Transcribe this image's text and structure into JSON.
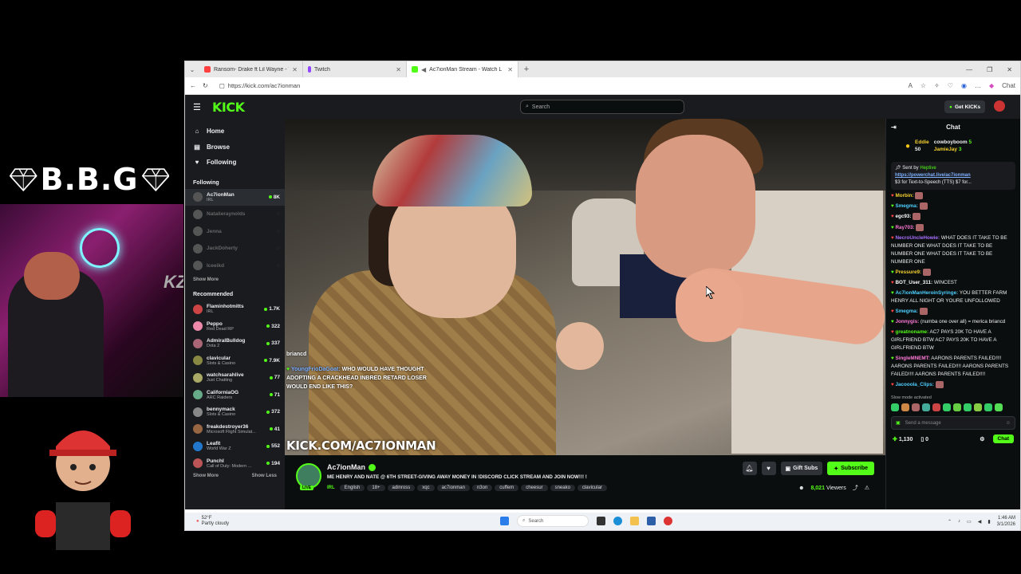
{
  "overlay": {
    "brand_text": "B.B.G",
    "cam_logo": "KZ"
  },
  "browser": {
    "tabs": [
      {
        "label": "Ransom- Drake ft Lil Wayne - You",
        "icon": "youtube-icon",
        "color": "#ff4040"
      },
      {
        "label": "Twitch",
        "icon": "twitch-icon",
        "color": "#9146ff"
      },
      {
        "label": "Ac7ionMan Stream - Watch L",
        "icon": "kick-icon",
        "color": "#53fc18"
      }
    ],
    "url": "https://kick.com/ac7ionman",
    "chat_label": "Chat"
  },
  "kick": {
    "logo": "KICK",
    "search_placeholder": "Search",
    "get_kicks": "Get KICKs",
    "nav": [
      {
        "label": "Home",
        "icon": "home-icon",
        "glyph": "⌂"
      },
      {
        "label": "Browse",
        "icon": "browse-icon",
        "glyph": "▤"
      },
      {
        "label": "Following",
        "icon": "heart-icon",
        "glyph": "♥"
      }
    ],
    "following_title": "Following",
    "following": [
      {
        "name": "Ac7ionMan",
        "game": "IRL",
        "viewers": "8K",
        "live": true
      },
      {
        "name": "Natalieraynolds",
        "game": "",
        "viewers": "",
        "live": false
      },
      {
        "name": "Jenna",
        "game": "",
        "viewers": "",
        "live": false
      },
      {
        "name": "JackDoherty",
        "game": "",
        "viewers": "",
        "live": false
      },
      {
        "name": "Iceeikd",
        "game": "",
        "viewers": "",
        "live": false
      }
    ],
    "show_more": "Show More",
    "recommended_title": "Recommended",
    "recommended": [
      {
        "name": "Flaminhotmitts",
        "game": "IRL",
        "viewers": "1.7K"
      },
      {
        "name": "Peppo",
        "game": "Red Dead RP",
        "viewers": "322"
      },
      {
        "name": "AdmiralBulldog",
        "game": "Dota 2",
        "viewers": "337"
      },
      {
        "name": "clavicular",
        "game": "Slots & Casino",
        "viewers": "7.9K"
      },
      {
        "name": "watchsarahlive",
        "game": "Just Chatting",
        "viewers": "77"
      },
      {
        "name": "CaliforniaOG",
        "game": "ARC Raiders",
        "viewers": "71"
      },
      {
        "name": "bennymack",
        "game": "Slots & Casino",
        "viewers": "372"
      },
      {
        "name": "freakdestroyer36",
        "game": "Microsoft Flight Simulat...",
        "viewers": "41"
      },
      {
        "name": "Leafit",
        "game": "World War Z",
        "viewers": "552"
      },
      {
        "name": "PunchI",
        "game": "Call of Duty: Modern ...",
        "viewers": "194"
      }
    ],
    "show_more2": "Show More",
    "show_less": "Show Less",
    "video": {
      "overlay_chat": [
        {
          "user": "",
          "text": "briancd"
        },
        {
          "user": "YoungFrioDaGoat:",
          "text": "WHO WOULD HAVE THOUGHT ADOPTING A CRACKHEAD INBRED RETARD LOSER WOULD END LIKE THIS?"
        }
      ],
      "watermark": "KICK.COM/AC7IONMAN"
    },
    "stream": {
      "name": "Ac7ionMan",
      "live": "LIVE",
      "title": "ME HENRY AND NATE @ 6TH STREET-GIVING AWAY MONEY IN !DISCORD CLICK STREAM AND JOIN NOW!!! !",
      "category": "IRL",
      "tags": [
        "English",
        "18+",
        "adinross",
        "xqc",
        "ac7ionman",
        "n3on",
        "cuffem",
        "cheesur",
        "sneako",
        "clavicular"
      ],
      "gift_subs": "Gift Subs",
      "subscribe": "Subscribe",
      "viewers": "8,021",
      "viewers_label": "Viewers"
    },
    "chat": {
      "title": "Chat",
      "leaders": [
        {
          "name": "Eddie",
          "count": "50"
        },
        {
          "name": "cowboyboom",
          "count": "5"
        },
        {
          "name": "JamieJay",
          "count": "3"
        }
      ],
      "pinned_sender": "Sent by",
      "pinned_user": "Heptive",
      "pinned_link": "https://powerchat.live/ac7ionman",
      "pinned_text": "$3 for Text-to-Speech (TTS) $7 for...",
      "messages": [
        {
          "user": "Morbin:",
          "text": "",
          "color": "#f5d130"
        },
        {
          "user": "Smegma:",
          "text": "",
          "color": "#4dd0ff"
        },
        {
          "user": "egc93:",
          "text": "",
          "color": "#ffffff"
        },
        {
          "user": "Ray703:",
          "text": "",
          "color": "#ff7ad9"
        },
        {
          "user": "NecroUncleHowie:",
          "text": "WHAT DOES IT TAKE TO BE NUMBER ONE WHAT DOES IT TAKE TO BE NUMBER ONE WHAT DOES IT TAKE TO BE NUMBER ONE",
          "color": "#a970ff"
        },
        {
          "user": "Pressure9:",
          "text": "",
          "color": "#f5d130"
        },
        {
          "user": "BOT_User_311:",
          "text": "WINCEST",
          "color": "#ffffff"
        },
        {
          "user": "Ac7ionManHeroinSyringe:",
          "text": "YOU BETTER FARM HENRY ALL NIGHT OR YOURE UNFOLLOWED",
          "color": "#4dd0ff"
        },
        {
          "user": "Smegma:",
          "text": "",
          "color": "#4dd0ff"
        },
        {
          "user": "Jonnygis:",
          "text": "(numba one over all) = merica briancd",
          "color": "#ff7ad9"
        },
        {
          "user": "greatnoname:",
          "text": "AC7 PAYS 20K TO HAVE A GIRLFRIEND BTW AC7 PAYS 20K TO HAVE A GIRLFRIEND BTW",
          "color": "#53fc18"
        },
        {
          "user": "SingleMNEMT:",
          "text": "AARONS PARENTS FAILED!!!! AARONS PARENTS FAILED!!!! AARONS PARENTS FAILED!!!! AARONS PARENTS FAILED!!!!",
          "color": "#ff7ad9"
        },
        {
          "user": "Jacooola_Clips:",
          "text": "",
          "color": "#4dd0ff"
        }
      ],
      "slow_mode": "Slow mode activated",
      "send_placeholder": "Send a message",
      "points": "1,130",
      "kicks": "0",
      "chat_button": "Chat"
    }
  },
  "taskbar": {
    "temp": "52°F",
    "weather": "Partly cloudy",
    "search": "Search",
    "time": "1:46 AM",
    "date": "3/1/2026"
  }
}
